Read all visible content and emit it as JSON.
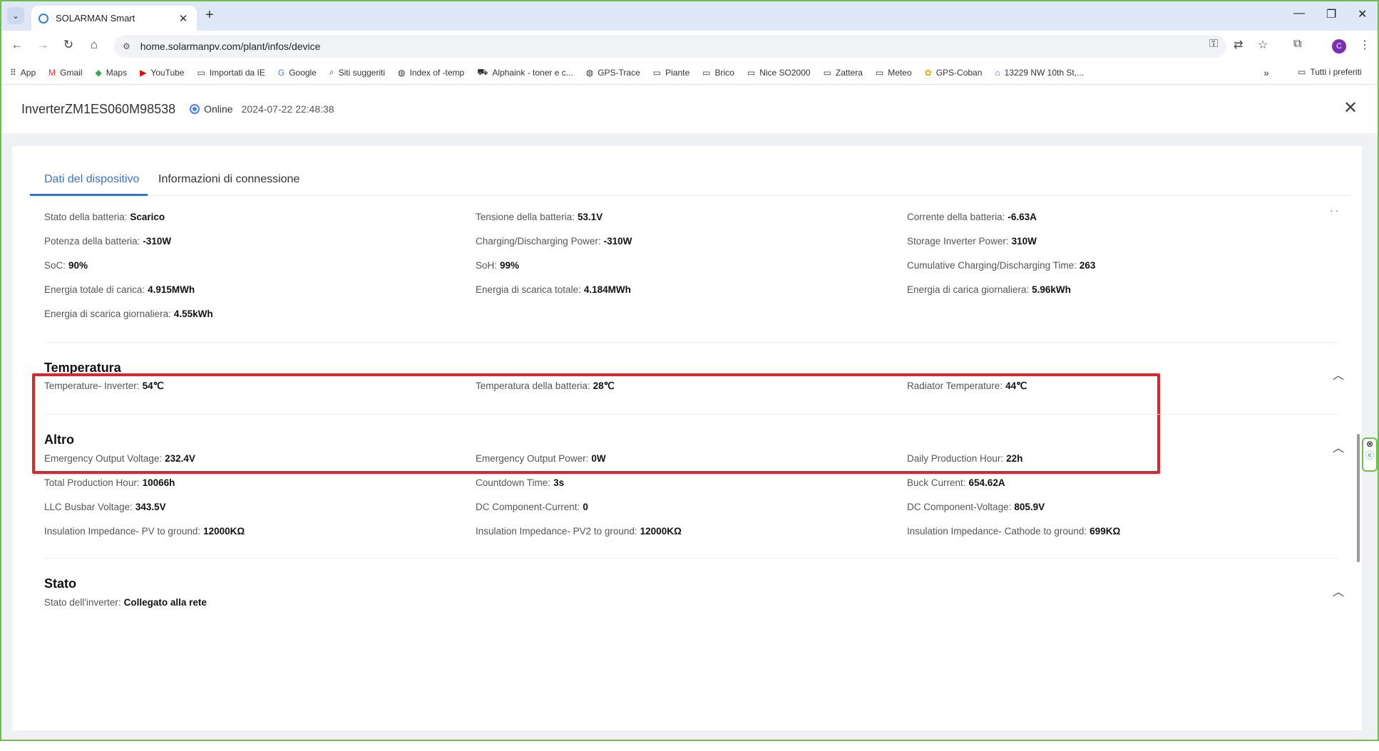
{
  "browser": {
    "tab_title": "SOLARMAN Smart",
    "url": "home.solarmanpv.com/plant/infos/device",
    "avatar_letter": "C",
    "bookmarks": [
      "App",
      "Gmail",
      "Maps",
      "YouTube",
      "Importati da IE",
      "Google",
      "Siti suggeriti",
      "Index of -temp",
      "Alphaink - toner e c...",
      "GPS-Trace",
      "Piante",
      "Brico",
      "Nice SO2000",
      "Zattera",
      "Meteo",
      "GPS-Coban",
      "13229 NW 10th St,..."
    ],
    "all_bookmarks": "Tutti i preferiti"
  },
  "device": {
    "name": "InverterZM1ES060M98538",
    "status": "Online",
    "timestamp": "2024-07-22 22:48:38"
  },
  "tabs": [
    "Dati del dispositivo",
    "Informazioni di connessione"
  ],
  "battery_rows": [
    [
      {
        "label": "Stato della batteria:",
        "value": "Scarico"
      },
      {
        "label": "Tensione della batteria:",
        "value": "53.1V"
      },
      {
        "label": "Corrente della batteria:",
        "value": "-6.63A"
      }
    ],
    [
      {
        "label": "Potenza della batteria:",
        "value": "-310W"
      },
      {
        "label": "Charging/Discharging Power:",
        "value": "-310W"
      },
      {
        "label": "Storage Inverter Power:",
        "value": "310W"
      }
    ],
    [
      {
        "label": "SoC:",
        "value": "90%"
      },
      {
        "label": "SoH:",
        "value": "99%"
      },
      {
        "label": "Cumulative Charging/Discharging Time:",
        "value": "263"
      }
    ],
    [
      {
        "label": "Energia totale di carica:",
        "value": "4.915MWh"
      },
      {
        "label": "Energia di scarica totale:",
        "value": "4.184MWh"
      },
      {
        "label": "Energia di carica giornaliera:",
        "value": "5.96kWh"
      }
    ],
    [
      {
        "label": "Energia di scarica giornaliera:",
        "value": "4.55kWh"
      }
    ]
  ],
  "temperature": {
    "title": "Temperatura",
    "items": [
      {
        "label": "Temperature- Inverter:",
        "value": "54℃"
      },
      {
        "label": "Temperatura della batteria:",
        "value": "28℃"
      },
      {
        "label": "Radiator Temperature:",
        "value": "44℃"
      }
    ]
  },
  "altro": {
    "title": "Altro",
    "rows": [
      [
        {
          "label": "Emergency Output Voltage:",
          "value": "232.4V"
        },
        {
          "label": "Emergency Output Power:",
          "value": "0W"
        },
        {
          "label": "Daily Production Hour:",
          "value": "22h"
        }
      ],
      [
        {
          "label": "Total Production Hour:",
          "value": "10066h"
        },
        {
          "label": "Countdown Time:",
          "value": "3s"
        },
        {
          "label": "Buck Current:",
          "value": "654.62A"
        }
      ],
      [
        {
          "label": "LLC Busbar Voltage:",
          "value": "343.5V"
        },
        {
          "label": "DC Component-Current:",
          "value": "0"
        },
        {
          "label": "DC Component-Voltage:",
          "value": "805.9V"
        }
      ],
      [
        {
          "label": "Insulation Impedance- PV to ground:",
          "value": "12000KΩ"
        },
        {
          "label": "Insulation Impedance- PV2 to ground:",
          "value": "12000KΩ"
        },
        {
          "label": "Insulation Impedance- Cathode to ground:",
          "value": "699KΩ"
        }
      ]
    ]
  },
  "stato": {
    "title": "Stato",
    "items": [
      {
        "label": "Stato dell'inverter:",
        "value": "Collegato alla rete"
      }
    ]
  }
}
